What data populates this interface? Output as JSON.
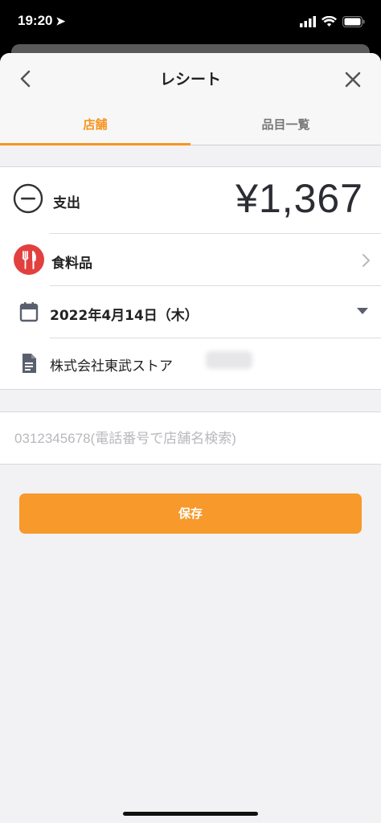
{
  "status_bar": {
    "time": "19:20"
  },
  "header": {
    "title": "レシート"
  },
  "tabs": [
    {
      "label": "店舗",
      "active": true
    },
    {
      "label": "品目一覧",
      "active": false
    }
  ],
  "transaction": {
    "type_label": "支出",
    "amount": "¥1,367"
  },
  "category": {
    "label": "食料品"
  },
  "date": {
    "value": "2022年4月14日（木）"
  },
  "store": {
    "name": "株式会社東武ストア"
  },
  "search": {
    "placeholder": "0312345678(電話番号で店舗名検索)"
  },
  "actions": {
    "save_label": "保存"
  },
  "colors": {
    "accent": "#f7941d",
    "category": "#e2403f",
    "text": "#222222"
  }
}
